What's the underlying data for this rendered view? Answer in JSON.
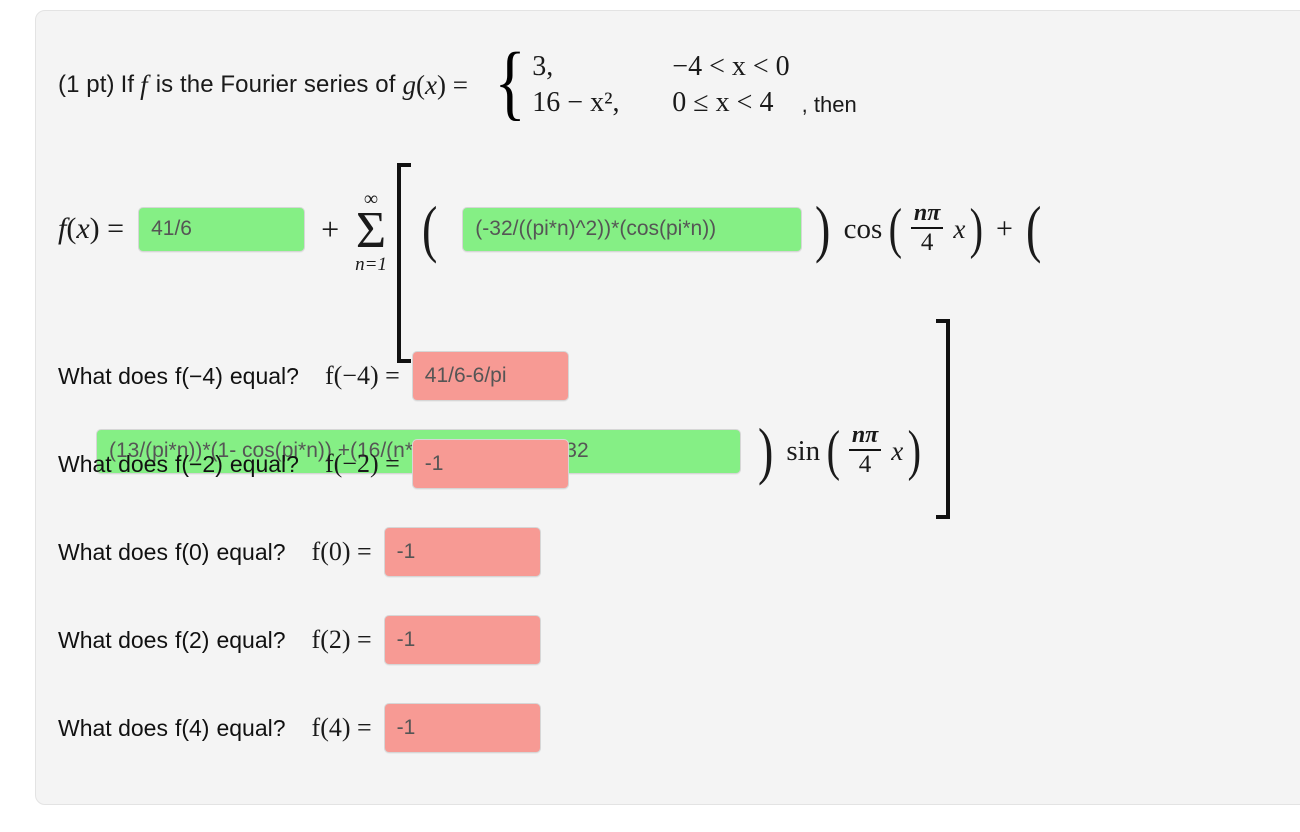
{
  "problem": {
    "points_label": "(1 pt)",
    "intro_text": "If",
    "function_symbol": "f",
    "intro_text2": "is the Fourier series of",
    "g_label": "g(x) =",
    "piecewise": {
      "rows": [
        {
          "value": "3,",
          "condition": "−4 < x < 0"
        },
        {
          "value": "16 − x²,",
          "condition": "0 ≤ x < 4"
        }
      ]
    },
    "then_label": ", then"
  },
  "formula": {
    "lhs": "f(x) =",
    "a0_value": "41/6",
    "plus_symbol": "+",
    "sum_upper": "∞",
    "sum_symbol": "Σ",
    "sum_lower": "n=1",
    "open_paren": "(",
    "close_paren": ")",
    "an_value": "(-32/((pi*n)^2))*(cos(pi*n))",
    "cos_label": "cos",
    "frac_num": "nπ",
    "frac_den": "4",
    "x_var": "x",
    "plus_between": "+",
    "bn_value": "(13/(pi*n))*(1- cos(pi*n)) +(16/(n*pi))*cos(pi*n) + (32",
    "sin_label": "sin"
  },
  "questions": [
    {
      "prompt_prefix": "What does",
      "fn_label": "f(−4)",
      "prompt_suffix": "equal?",
      "restate": "f(−4) =",
      "answer": "41/6-6/pi",
      "box_color": "#f79a94"
    },
    {
      "prompt_prefix": "What does",
      "fn_label": "f(−2)",
      "prompt_suffix": "equal?",
      "restate": "f(−2) =",
      "answer": "-1",
      "box_color": "#f79a94"
    },
    {
      "prompt_prefix": "What does",
      "fn_label": "f(0)",
      "prompt_suffix": "equal?",
      "restate": "f(0) =",
      "answer": "-1",
      "box_color": "#f79a94"
    },
    {
      "prompt_prefix": "What does",
      "fn_label": "f(2)",
      "prompt_suffix": "equal?",
      "restate": "f(2) =",
      "answer": "-1",
      "box_color": "#f79a94"
    },
    {
      "prompt_prefix": "What does",
      "fn_label": "f(4)",
      "prompt_suffix": "equal?",
      "restate": "f(4) =",
      "answer": "-1",
      "box_color": "#f79a94"
    }
  ],
  "colors": {
    "correct_green": "#85ef85",
    "incorrect_pink": "#f79a94",
    "card_background": "#f4f4f4",
    "card_border": "#e3e3e3",
    "input_border": "#d6d6d6",
    "answer_text": "#555555"
  }
}
